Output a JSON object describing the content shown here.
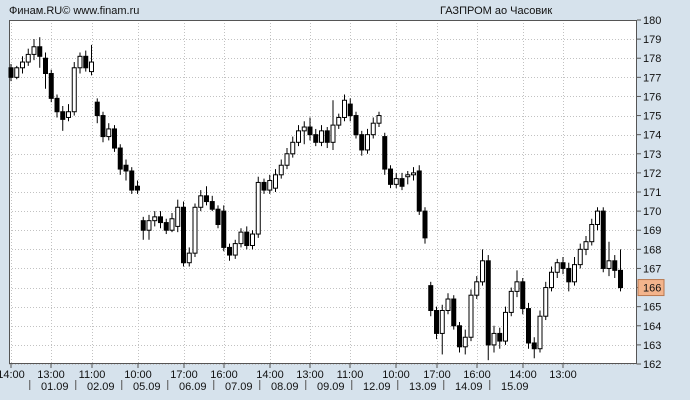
{
  "header": {
    "source": "Финам.RU© www.finam.ru",
    "title": "ГАЗПРОМ ао Часовик"
  },
  "chart_data": {
    "type": "candlestick",
    "ylim": [
      162,
      180
    ],
    "y_ticks": [
      162,
      163,
      164,
      165,
      166,
      167,
      168,
      169,
      170,
      171,
      172,
      173,
      174,
      175,
      176,
      177,
      178,
      179,
      180
    ],
    "x_time_labels": [
      {
        "i": 0,
        "label": "14:00"
      },
      {
        "i": 7,
        "label": "13:00"
      },
      {
        "i": 14,
        "label": "11:00"
      },
      {
        "i": 22,
        "label": "10:00"
      },
      {
        "i": 30,
        "label": "17:00"
      },
      {
        "i": 37,
        "label": "16:00"
      },
      {
        "i": 45,
        "label": "14:00"
      },
      {
        "i": 52,
        "label": "13:00"
      },
      {
        "i": 59,
        "label": "11:00"
      },
      {
        "i": 67,
        "label": "10:00"
      },
      {
        "i": 74,
        "label": "17:00"
      },
      {
        "i": 81,
        "label": "16:00"
      },
      {
        "i": 89,
        "label": "14:00"
      },
      {
        "i": 96,
        "label": "13:00"
      }
    ],
    "x_date_labels": [
      {
        "i": 5,
        "label": "01.09"
      },
      {
        "i": 13,
        "label": "02.09"
      },
      {
        "i": 21,
        "label": "05.09"
      },
      {
        "i": 29,
        "label": "06.09"
      },
      {
        "i": 37,
        "label": "07.09"
      },
      {
        "i": 45,
        "label": "08.09"
      },
      {
        "i": 53,
        "label": "09.09"
      },
      {
        "i": 61,
        "label": "12.09"
      },
      {
        "i": 69,
        "label": "13.09"
      },
      {
        "i": 77,
        "label": "14.09"
      },
      {
        "i": 85,
        "label": "15.09"
      }
    ],
    "last_price": 166,
    "candles": [
      [
        177.5,
        177.0,
        177.7,
        176.8
      ],
      [
        177.0,
        177.5,
        177.6,
        176.9
      ],
      [
        177.5,
        177.8,
        178.1,
        177.2
      ],
      [
        177.8,
        178.2,
        178.5,
        177.6
      ],
      [
        178.2,
        178.6,
        179.0,
        177.9
      ],
      [
        178.6,
        178.1,
        179.1,
        177.5
      ],
      [
        178.0,
        177.2,
        178.3,
        176.4
      ],
      [
        177.2,
        175.9,
        177.4,
        175.7
      ],
      [
        175.9,
        175.2,
        176.1,
        174.9
      ],
      [
        175.2,
        174.8,
        175.5,
        174.2
      ],
      [
        174.9,
        175.2,
        175.6,
        174.7
      ],
      [
        175.2,
        177.5,
        177.8,
        175.0
      ],
      [
        177.5,
        178.1,
        178.3,
        177.2
      ],
      [
        178.1,
        177.5,
        178.4,
        177.3
      ],
      [
        177.3,
        177.8,
        178.7,
        177.1
      ],
      [
        175.7,
        175.0,
        175.9,
        174.6
      ],
      [
        175.0,
        173.9,
        175.2,
        173.6
      ],
      [
        173.9,
        174.3,
        174.6,
        173.7
      ],
      [
        174.3,
        173.3,
        174.5,
        173.1
      ],
      [
        173.3,
        172.2,
        173.5,
        171.9
      ],
      [
        172.4,
        172.1,
        172.7,
        171.6
      ],
      [
        172.1,
        171.1,
        172.3,
        170.9
      ],
      [
        171.3,
        171.1,
        171.6,
        170.9
      ],
      [
        169.5,
        169.0,
        169.7,
        168.5
      ],
      [
        169.0,
        169.5,
        169.8,
        168.5
      ],
      [
        169.5,
        169.7,
        170.0,
        169.2
      ],
      [
        169.7,
        169.4,
        170.0,
        169.1
      ],
      [
        169.4,
        169.0,
        169.6,
        168.8
      ],
      [
        169.0,
        169.6,
        169.9,
        168.9
      ],
      [
        169.2,
        170.2,
        170.6,
        168.9
      ],
      [
        170.2,
        167.3,
        170.5,
        167.1
      ],
      [
        167.3,
        167.8,
        168.1,
        167.1
      ],
      [
        167.8,
        170.2,
        170.4,
        167.6
      ],
      [
        170.2,
        170.8,
        171.1,
        170.0
      ],
      [
        170.8,
        170.5,
        171.3,
        170.3
      ],
      [
        170.5,
        170.1,
        170.8,
        170.0
      ],
      [
        170.1,
        169.3,
        170.3,
        169.1
      ],
      [
        170.0,
        168.1,
        170.3,
        167.9
      ],
      [
        168.1,
        167.7,
        168.3,
        167.4
      ],
      [
        167.7,
        168.3,
        168.5,
        167.5
      ],
      [
        168.3,
        168.9,
        169.1,
        168.1
      ],
      [
        168.9,
        168.2,
        169.2,
        168.0
      ],
      [
        168.2,
        168.8,
        169.0,
        168.0
      ],
      [
        168.8,
        171.5,
        171.8,
        168.6
      ],
      [
        171.5,
        171.1,
        171.7,
        170.9
      ],
      [
        171.1,
        171.6,
        171.9,
        170.9
      ],
      [
        171.2,
        171.9,
        172.2,
        171.0
      ],
      [
        171.9,
        172.4,
        172.7,
        171.7
      ],
      [
        172.4,
        173.0,
        173.3,
        172.2
      ],
      [
        173.0,
        173.6,
        173.9,
        172.8
      ],
      [
        173.6,
        174.2,
        174.5,
        173.4
      ],
      [
        174.2,
        174.4,
        174.7,
        173.5
      ],
      [
        174.4,
        174.0,
        174.9,
        173.7
      ],
      [
        174.0,
        173.6,
        174.3,
        173.4
      ],
      [
        173.6,
        174.2,
        174.5,
        173.4
      ],
      [
        174.2,
        173.6,
        174.4,
        173.3
      ],
      [
        173.6,
        174.5,
        175.8,
        173.2
      ],
      [
        174.5,
        174.9,
        175.1,
        174.3
      ],
      [
        174.9,
        175.8,
        176.1,
        174.7
      ],
      [
        175.6,
        175.0,
        175.9,
        174.7
      ],
      [
        175.0,
        174.0,
        175.2,
        173.8
      ],
      [
        174.0,
        173.2,
        174.2,
        172.9
      ],
      [
        173.2,
        174.0,
        174.3,
        173.0
      ],
      [
        174.0,
        174.6,
        174.9,
        173.8
      ],
      [
        174.6,
        175.0,
        175.2,
        174.4
      ],
      [
        173.9,
        172.2,
        174.1,
        171.9
      ],
      [
        172.2,
        171.4,
        172.4,
        171.2
      ],
      [
        171.4,
        171.7,
        172.0,
        171.2
      ],
      [
        171.7,
        171.3,
        172.0,
        171.1
      ],
      [
        171.8,
        171.9,
        172.1,
        171.4
      ],
      [
        171.9,
        172.0,
        172.3,
        171.6
      ],
      [
        172.1,
        170.0,
        172.4,
        169.8
      ],
      [
        170.0,
        168.6,
        170.2,
        168.3
      ],
      [
        166.1,
        164.8,
        166.3,
        164.5
      ],
      [
        164.8,
        163.6,
        165.0,
        163.3
      ],
      [
        163.6,
        164.8,
        165.1,
        162.5
      ],
      [
        164.8,
        165.4,
        165.7,
        164.6
      ],
      [
        165.4,
        164.0,
        165.6,
        163.8
      ],
      [
        164.0,
        162.9,
        164.2,
        162.6
      ],
      [
        162.9,
        163.4,
        163.8,
        162.5
      ],
      [
        163.4,
        165.6,
        165.9,
        163.2
      ],
      [
        165.6,
        166.3,
        166.6,
        165.4
      ],
      [
        166.3,
        167.4,
        168.0,
        166.1
      ],
      [
        167.4,
        163.0,
        167.7,
        162.2
      ],
      [
        163.0,
        163.6,
        164.0,
        162.6
      ],
      [
        163.6,
        163.2,
        163.9,
        162.8
      ],
      [
        163.2,
        164.7,
        165.0,
        163.0
      ],
      [
        164.7,
        165.8,
        166.0,
        164.5
      ],
      [
        165.8,
        166.3,
        166.9,
        165.5
      ],
      [
        166.3,
        164.9,
        166.5,
        164.6
      ],
      [
        164.9,
        163.1,
        165.2,
        162.8
      ],
      [
        163.1,
        162.8,
        163.4,
        162.3
      ],
      [
        162.8,
        164.5,
        164.8,
        162.6
      ],
      [
        164.5,
        166.0,
        166.3,
        164.3
      ],
      [
        166.0,
        166.8,
        167.1,
        165.8
      ],
      [
        166.8,
        167.3,
        167.5,
        166.5
      ],
      [
        167.3,
        167.0,
        167.6,
        166.7
      ],
      [
        167.0,
        166.3,
        167.3,
        165.8
      ],
      [
        166.3,
        167.2,
        167.6,
        166.1
      ],
      [
        167.2,
        168.0,
        168.3,
        167.0
      ],
      [
        168.0,
        168.4,
        168.7,
        167.7
      ],
      [
        168.4,
        169.3,
        169.6,
        168.2
      ],
      [
        169.3,
        170.0,
        170.2,
        169.0
      ],
      [
        170.0,
        167.0,
        170.2,
        166.8
      ],
      [
        167.0,
        167.4,
        168.4,
        166.6
      ],
      [
        167.4,
        166.9,
        167.7,
        166.5
      ],
      [
        166.9,
        166.0,
        168.0,
        165.8
      ]
    ]
  }
}
